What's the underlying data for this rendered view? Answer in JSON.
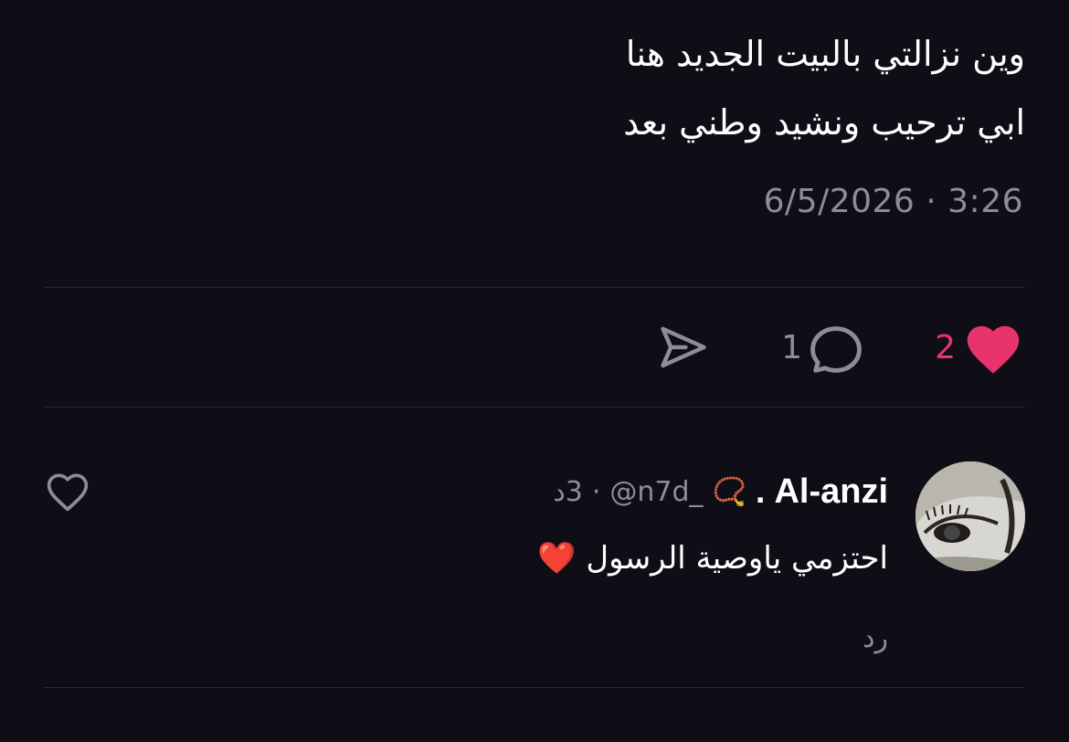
{
  "post": {
    "lines": [
      "وين نزالتي بالبيت الجديد هنا",
      "ابي ترحيب ونشيد وطني بعد"
    ],
    "timestamp": "6/5/2026 · 3:26"
  },
  "actions": {
    "like_count": "2",
    "reply_count": "1",
    "liked": true,
    "icons": [
      "heart-filled-icon",
      "comment-bubble-icon",
      "send-icon"
    ],
    "colors": {
      "like": "#e8336c",
      "muted": "#8e8d97"
    }
  },
  "comment": {
    "display_name": "Al-anzi",
    "name_suffix": ".",
    "name_emoji": "📿",
    "handle": "@n7d_",
    "separator": "·",
    "time_ago": "3د",
    "text": "احتزمي ياوصية الرسول ❤️",
    "reply_label": "رد",
    "icons": [
      "avatar-photo",
      "heart-outline-icon"
    ]
  },
  "theme": {
    "background": "#0f0e17",
    "divider": "#2a2933",
    "text": "#ffffff"
  }
}
